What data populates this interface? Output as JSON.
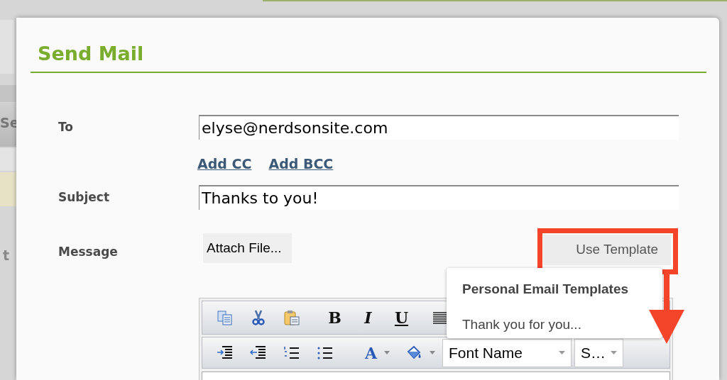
{
  "background": {
    "texts": [
      "Se",
      "t"
    ]
  },
  "dialog": {
    "title": "Send Mail",
    "fields": [
      {
        "label": "To",
        "value": "elyse@nerdsonsite.com"
      },
      {
        "label": "Subject",
        "value": "Thanks to you!"
      }
    ],
    "links": [
      "Add CC",
      "Add BCC"
    ],
    "message": {
      "label": "Message",
      "attach_button": "Attach File...",
      "template_button": "Use Template",
      "template_highlighted": true
    },
    "template_menu": {
      "header": "Personal Email Templates",
      "items": [
        "Thank you for you..."
      ]
    },
    "toolbar": {
      "row_1": [
        {
          "kind": "copy"
        },
        {
          "kind": "cut"
        },
        {
          "kind": "paste"
        },
        {
          "kind": "bold",
          "label": "B"
        },
        {
          "kind": "italic",
          "label": "I"
        },
        {
          "kind": "underline",
          "label": "U"
        },
        {
          "kind": "justify"
        }
      ],
      "row_2": [
        {
          "kind": "indent"
        },
        {
          "kind": "outdent"
        },
        {
          "kind": "ordered-list"
        },
        {
          "kind": "bullet-list"
        },
        {
          "kind": "text-color",
          "label": "A"
        },
        {
          "kind": "fill-color"
        }
      ],
      "font_select": "Font Name",
      "size_select": "S…"
    }
  }
}
